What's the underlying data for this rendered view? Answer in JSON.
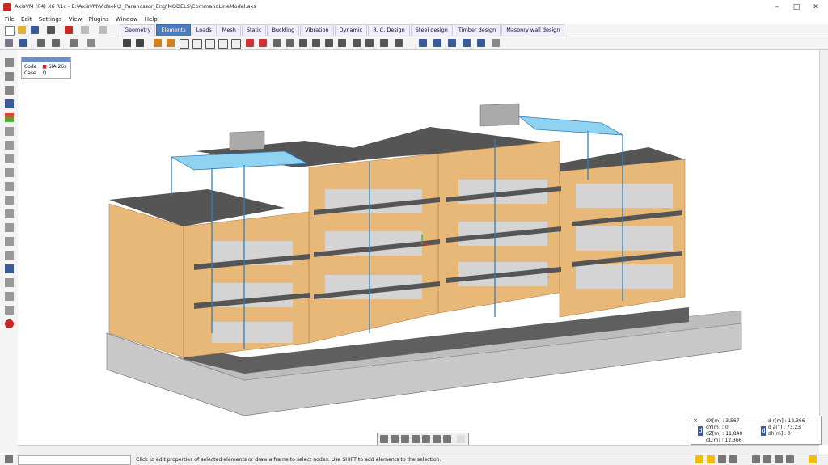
{
  "window": {
    "title": "AxisVM (64) X6 R1c - E:\\AxisVM\\Videok\\2_Parancssor_Eng\\MODELS\\CommandLineModel.axs",
    "minimize": "–",
    "maximize": "□",
    "close": "✕"
  },
  "menu": [
    "File",
    "Edit",
    "Settings",
    "View",
    "Plugins",
    "Window",
    "Help"
  ],
  "tabs": [
    "Geometry",
    "Elements",
    "Loads",
    "Mesh",
    "Static",
    "Buckling",
    "Vibration",
    "Dynamic",
    "R. C. Design",
    "Steel design",
    "Timber design",
    "Masonry wall design"
  ],
  "active_tab": "Elements",
  "info_panel": {
    "code_label": "Code",
    "code_value": "SIA 26x",
    "case_label": "Case",
    "case_value": "Q"
  },
  "coords": {
    "dx": "dX[m] : 3,567",
    "dy": "dY[m] : 0",
    "dz": "dZ[m] : 11,840",
    "dl": "dL[m] : 12,366",
    "dr": "d r[m] : 12,366",
    "da": "d a[°] : 73,23",
    "dh": "dh[m] : 0"
  },
  "status": {
    "message": "Click to edit properties of selected elements or draw a frame to select nodes. Use SHIFT to add elements to the selection."
  },
  "colors": {
    "active_tab": "#4a7cc4",
    "wall": "#e8b878",
    "slab": "#555555",
    "foundation": "#bdbdbd",
    "steel": "#2f7fc0"
  }
}
